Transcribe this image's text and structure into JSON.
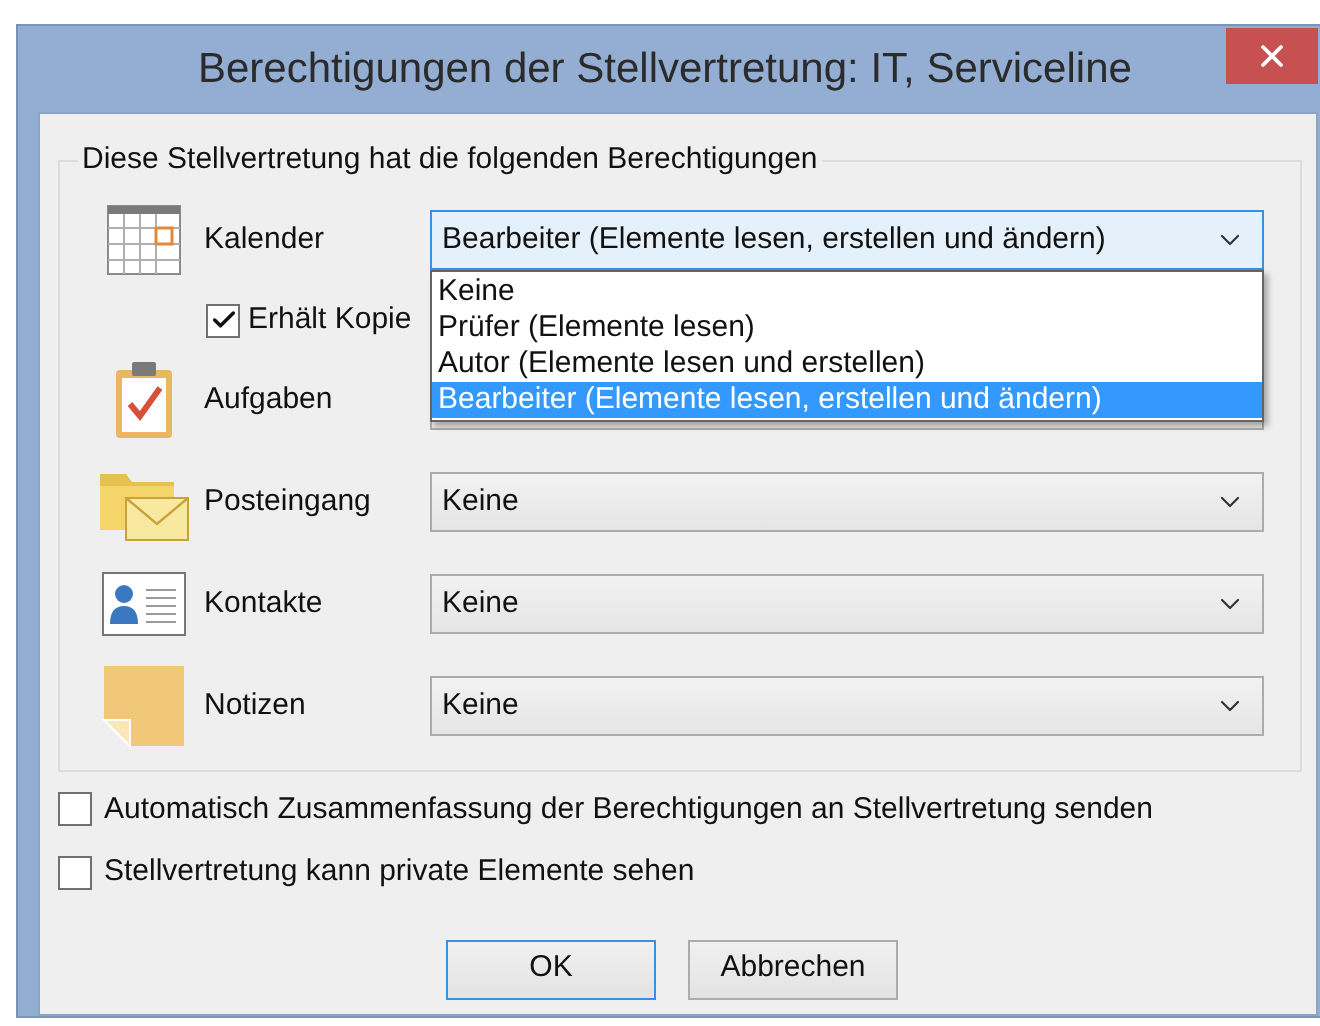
{
  "window": {
    "title": "Berechtigungen der Stellvertretung: IT, Serviceline"
  },
  "permissions_group": {
    "legend": "Diese Stellvertretung hat die folgenden Berechtigungen",
    "rows": [
      {
        "kind": "calendar",
        "label": "Kalender",
        "value": "Bearbeiter (Elemente lesen, erstellen und ändern)",
        "expanded": true,
        "options": [
          {
            "label": "Keine",
            "selected": false
          },
          {
            "label": "Prüfer (Elemente lesen)",
            "selected": false
          },
          {
            "label": "Autor (Elemente lesen und erstellen)",
            "selected": false
          },
          {
            "label": "Bearbeiter (Elemente lesen, erstellen und ändern)",
            "selected": true
          }
        ],
        "checkbox": {
          "label": "Erhält Kopie",
          "checked": true
        }
      },
      {
        "kind": "tasks",
        "label": "Aufgaben",
        "expanded": false
      },
      {
        "kind": "inbox",
        "label": "Posteingang",
        "value": "Keine",
        "expanded": false
      },
      {
        "kind": "contacts",
        "label": "Kontakte",
        "value": "Keine",
        "expanded": false
      },
      {
        "kind": "notes",
        "label": "Notizen",
        "value": "Keine",
        "expanded": false
      }
    ]
  },
  "options": [
    {
      "label": "Automatisch Zusammenfassung der Berechtigungen an Stellvertretung senden",
      "checked": false
    },
    {
      "label": "Stellvertretung kann private Elemente sehen",
      "checked": false
    }
  ],
  "buttons": [
    {
      "label": "OK",
      "default": true
    },
    {
      "label": "Abbrechen",
      "default": false
    }
  ]
}
